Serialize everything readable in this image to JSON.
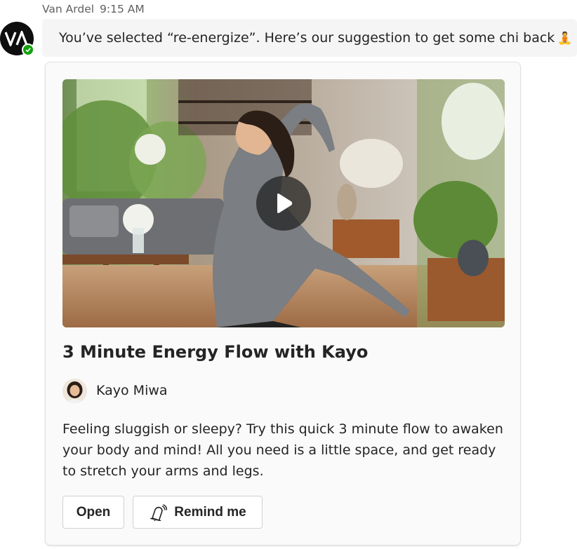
{
  "message": {
    "sender": "Van Ardel",
    "time": "9:15 AM",
    "avatar_initials": "VA",
    "presence": "available",
    "text": "You’ve selected “re-energize”.  Here’s our suggestion to get some chi back",
    "emoji": "🧘"
  },
  "card": {
    "media_icon": "play-icon",
    "title": "3 Minute Energy Flow with Kayo",
    "author": "Kayo Miwa",
    "description": "Feeling sluggish or sleepy? Try this quick 3 minute flow to awaken your body and mind! All you need is a little space, and get ready to stretch your arms and legs.",
    "actions": {
      "open_label": "Open",
      "remind_label": "Remind me",
      "remind_icon": "bell-ring-icon"
    }
  },
  "colors": {
    "presence_green": "#13a10e",
    "bubble_bg": "#f5f5f5",
    "card_bg": "#fafafa"
  }
}
